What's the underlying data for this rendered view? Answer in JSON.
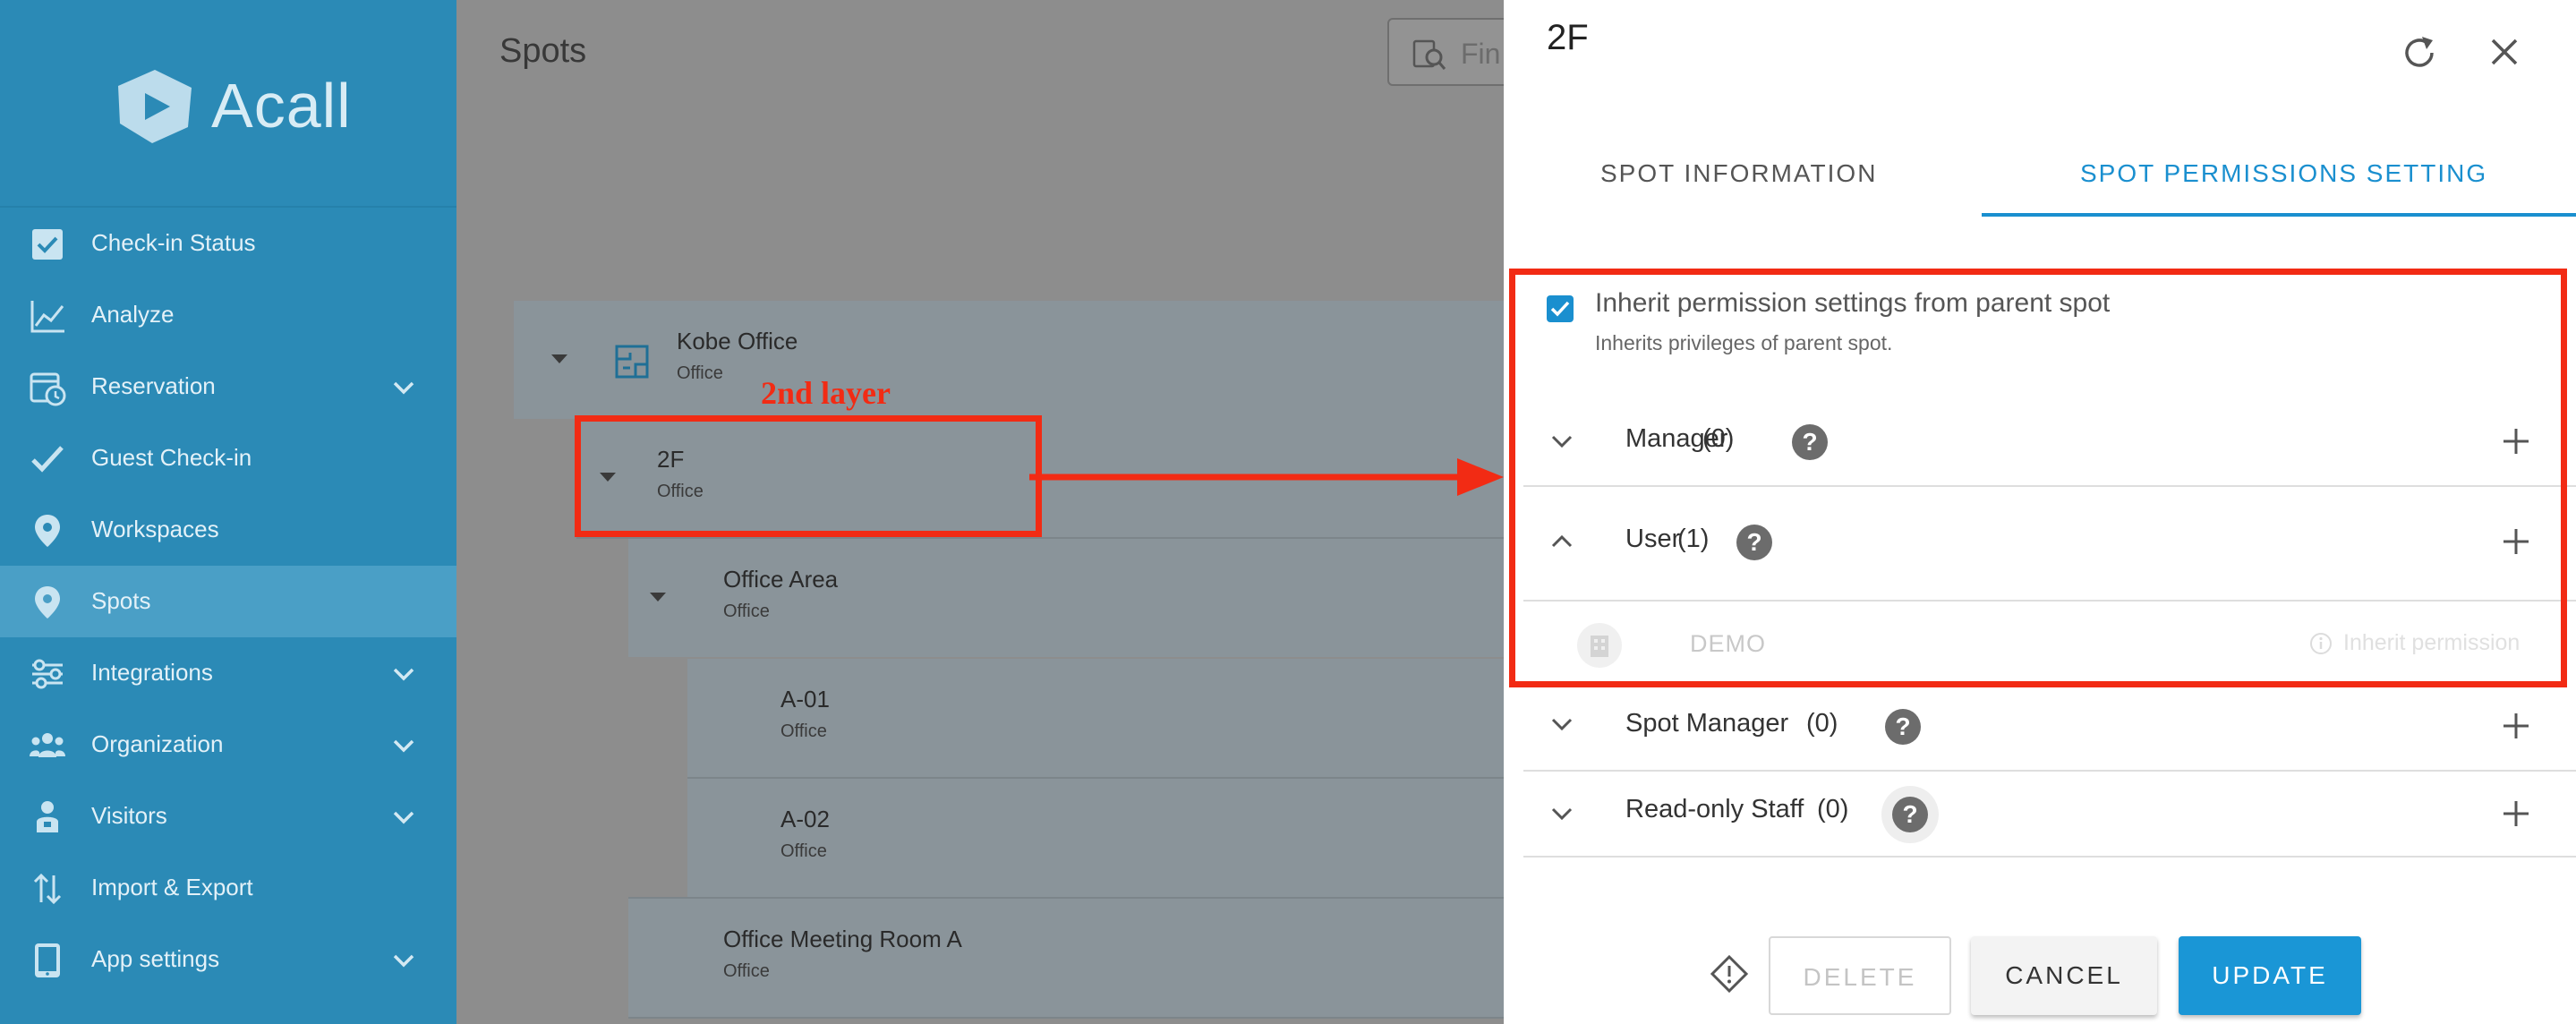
{
  "app": {
    "logo_text": "Acall"
  },
  "sidebar": {
    "items": [
      {
        "label": "Check-in Status",
        "icon": "checkbox-icon",
        "expandable": false,
        "active": false
      },
      {
        "label": "Analyze",
        "icon": "chart-icon",
        "expandable": false,
        "active": false
      },
      {
        "label": "Reservation",
        "icon": "calendar-clock-icon",
        "expandable": true,
        "active": false
      },
      {
        "label": "Guest Check-in",
        "icon": "check-icon",
        "expandable": false,
        "active": false
      },
      {
        "label": "Workspaces",
        "icon": "map-pin-icon",
        "expandable": false,
        "active": false
      },
      {
        "label": "Spots",
        "icon": "map-pin-icon",
        "expandable": false,
        "active": true
      },
      {
        "label": "Integrations",
        "icon": "integrations-icon",
        "expandable": true,
        "active": false
      },
      {
        "label": "Organization",
        "icon": "people-icon",
        "expandable": true,
        "active": false
      },
      {
        "label": "Visitors",
        "icon": "visitor-icon",
        "expandable": true,
        "active": false
      },
      {
        "label": "Import & Export",
        "icon": "import-export-icon",
        "expandable": false,
        "active": false
      },
      {
        "label": "App settings",
        "icon": "tablet-icon",
        "expandable": true,
        "active": false
      }
    ]
  },
  "main": {
    "title": "Spots",
    "search_placeholder": "Fin",
    "tree": [
      {
        "title": "Kobe Office",
        "subtitle": "Office"
      },
      {
        "title": "2F",
        "subtitle": "Office"
      },
      {
        "title": "Office Area",
        "subtitle": "Office"
      },
      {
        "title": "A-01",
        "subtitle": "Office"
      },
      {
        "title": "A-02",
        "subtitle": "Office"
      },
      {
        "title": "Office Meeting Room A",
        "subtitle": "Office"
      }
    ],
    "annotation": "2nd layer"
  },
  "panel": {
    "title": "2F",
    "tabs": [
      {
        "label": "SPOT INFORMATION",
        "active": false
      },
      {
        "label": "SPOT PERMISSIONS SETTING",
        "active": true
      }
    ],
    "inherit": {
      "checked": true,
      "label": "Inherit permission settings from parent spot",
      "description": "Inherits privileges of parent spot."
    },
    "groups": [
      {
        "label": "Manager",
        "count": "(0)",
        "expanded": false
      },
      {
        "label": "User",
        "count": "(1)",
        "expanded": true
      },
      {
        "label": "Spot Manager",
        "count": "(0)",
        "expanded": false
      },
      {
        "label": "Read-only Staff",
        "count": "(0)",
        "expanded": false
      }
    ],
    "user_members": [
      {
        "name": "DEMO",
        "note": "Inherit permission"
      }
    ],
    "buttons": {
      "delete": "DELETE",
      "cancel": "CANCEL",
      "update": "UPDATE"
    }
  },
  "colors": {
    "sidebar": "#2b8ab6",
    "accent": "#1a8fcf",
    "annotation": "#f22b14"
  }
}
